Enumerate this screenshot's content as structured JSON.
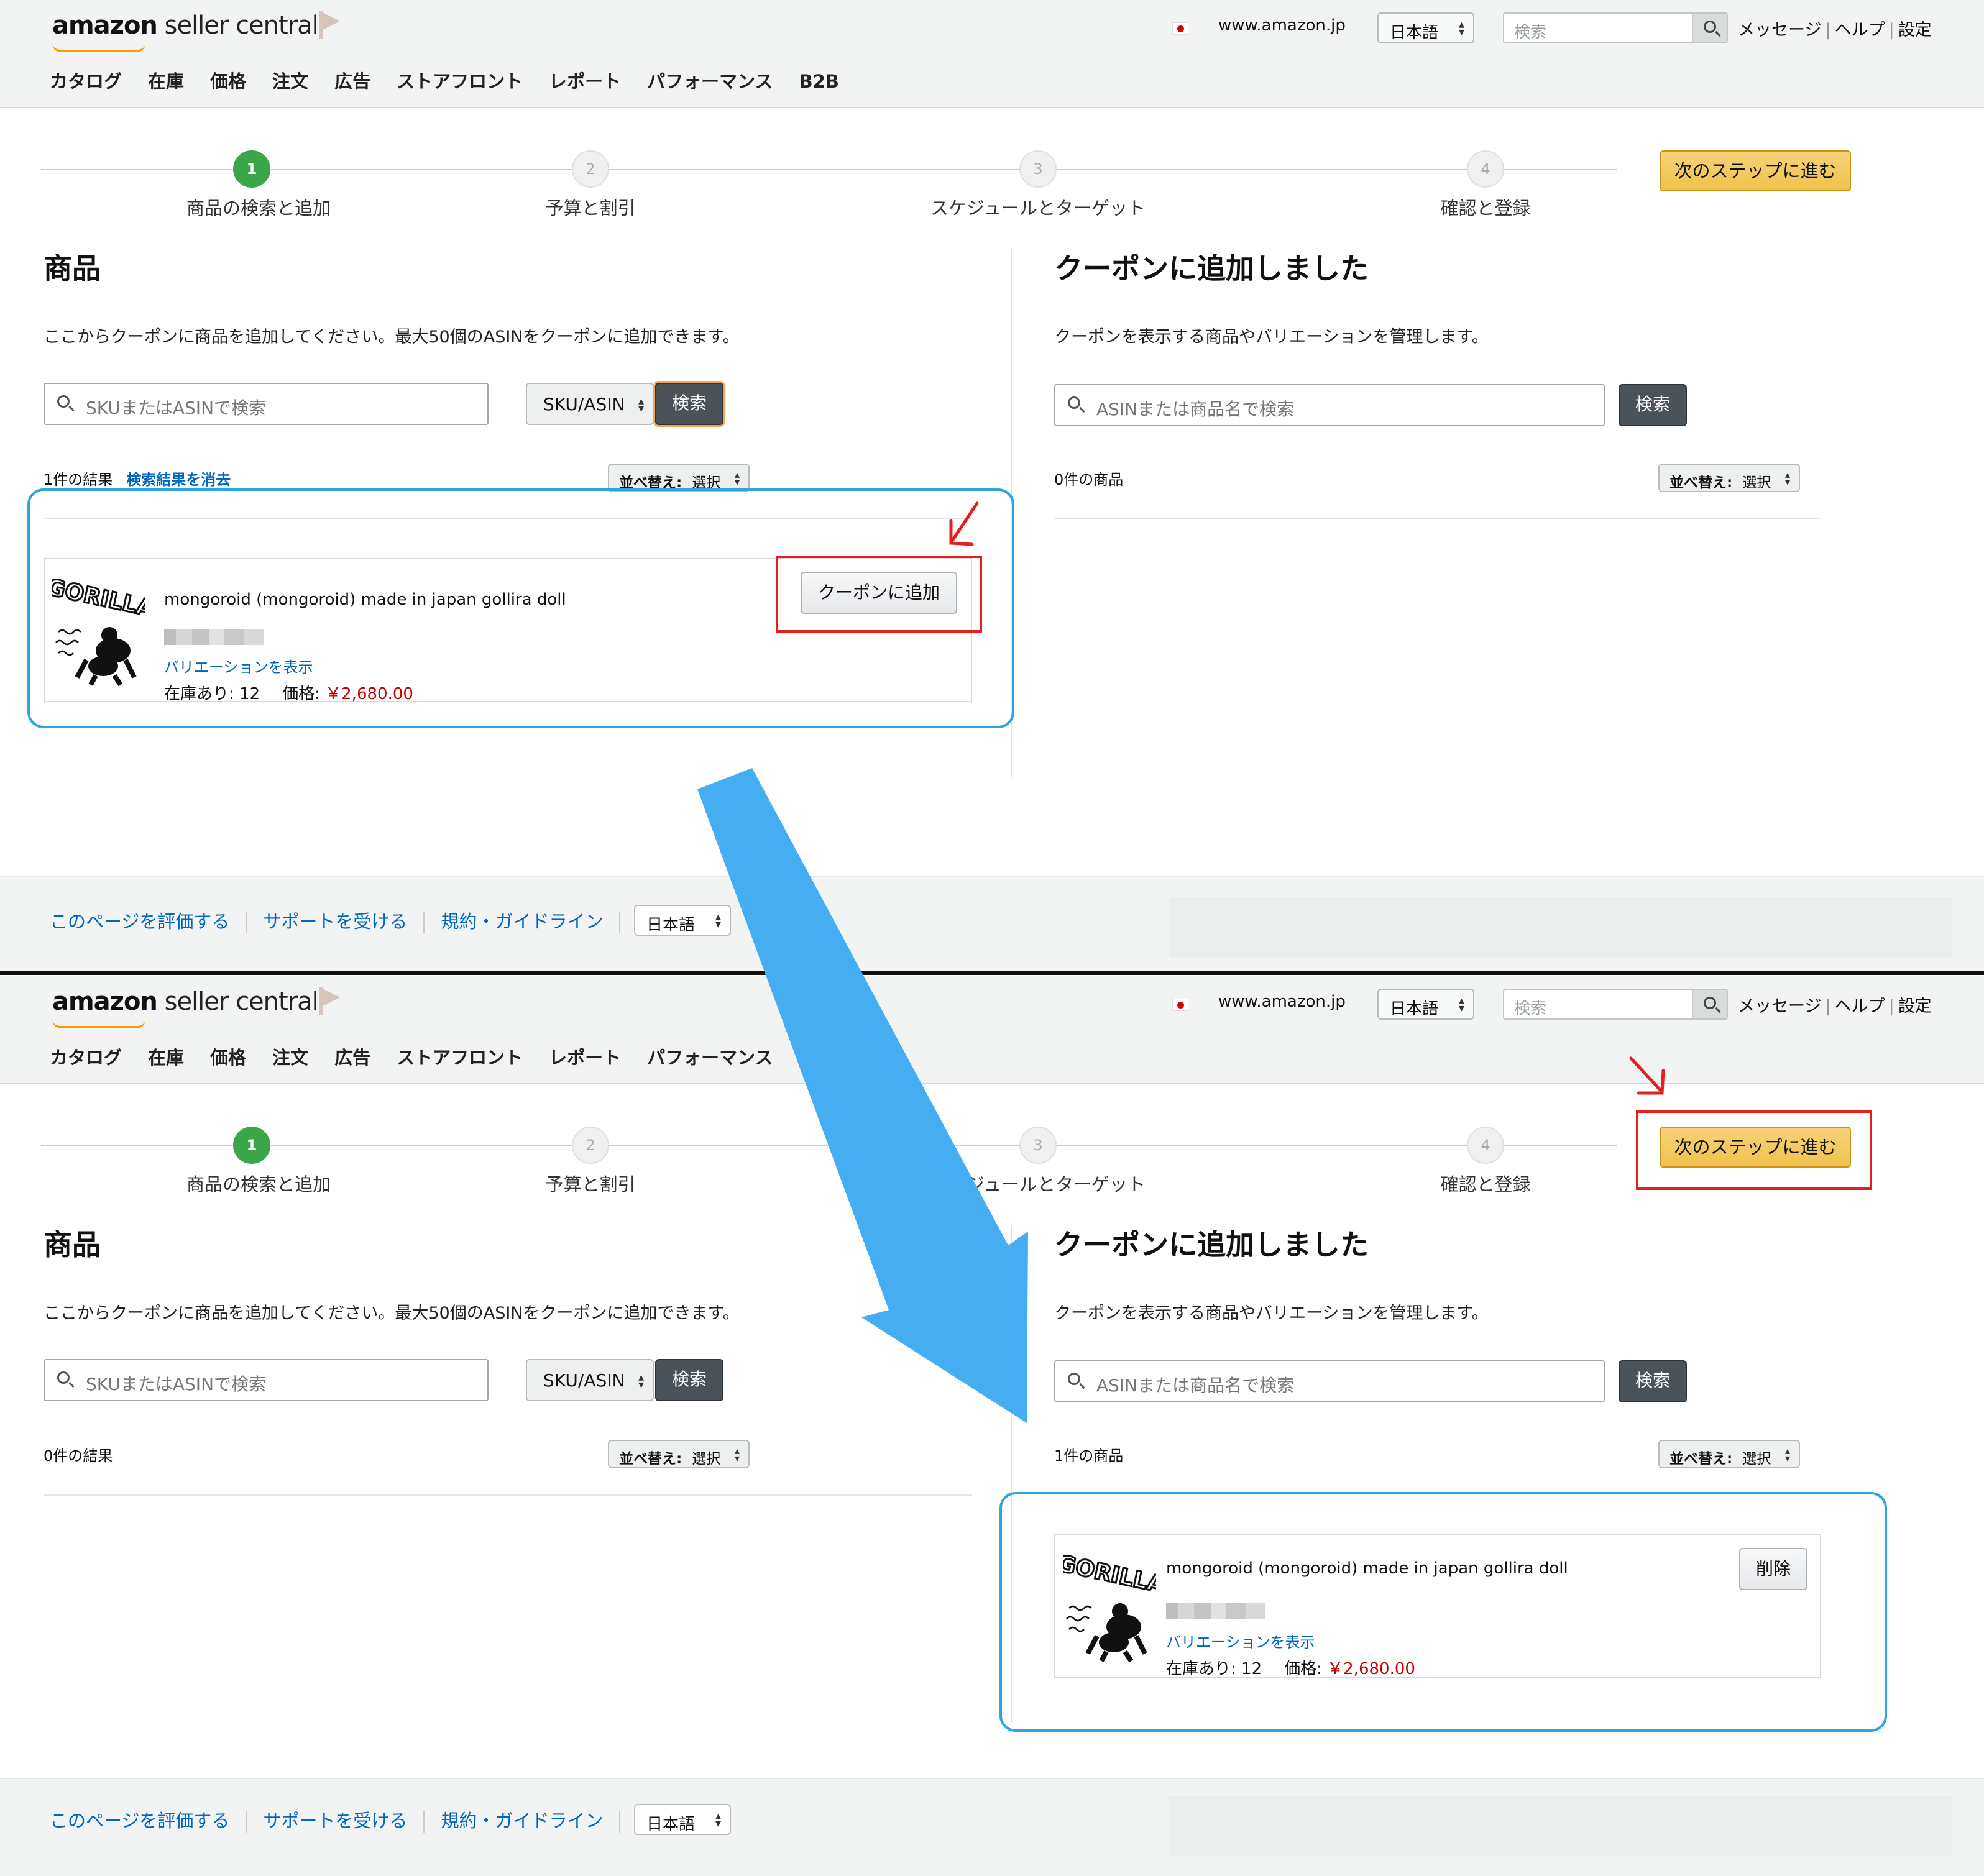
{
  "header": {
    "logo_amazon": "amazon",
    "logo_rest": " seller central",
    "site": "www.amazon.jp",
    "language": "日本語",
    "search_placeholder": "検索",
    "links": [
      "メッセージ",
      "ヘルプ",
      "設定"
    ],
    "nav": [
      "カタログ",
      "在庫",
      "価格",
      "注文",
      "広告",
      "ストアフロント",
      "レポート",
      "パフォーマンス",
      "B2B"
    ]
  },
  "stepper": {
    "steps": [
      {
        "num": "1",
        "label": "商品の検索と追加"
      },
      {
        "num": "2",
        "label": "予算と割引"
      },
      {
        "num": "3",
        "label": "スケジュールとターゲット"
      },
      {
        "num": "4",
        "label": "確認と登録"
      }
    ],
    "next_label": "次のステップに進む"
  },
  "left": {
    "title": "商品",
    "description": "ここからクーポンに商品を追加してください。最大50個のASINをクーポンに追加できます。",
    "search_placeholder": "SKUまたはASINで検索",
    "search_type": "SKU/ASIN",
    "search_button": "検索",
    "results_top": "1件の結果",
    "clear_results": "検索結果を消去",
    "results_bottom": "0件の結果",
    "sort_label": "並べ替え:",
    "sort_value": "選択"
  },
  "right": {
    "title": "クーポンに追加しました",
    "description": "クーポンを表示する商品やバリエーションを管理します。",
    "search_placeholder": "ASINまたは商品名で検索",
    "search_button": "検索",
    "count_top": "0件の商品",
    "count_bottom": "1件の商品",
    "sort_label": "並べ替え:",
    "sort_value": "選択"
  },
  "product": {
    "name": "mongoroid (mongoroid) made in japan gollira doll",
    "thumb_text": "GORILLA",
    "variation_link": "バリエーションを表示",
    "stock": "在庫あり: 12",
    "price_label": "価格:",
    "price": "￥2,680.00",
    "add_button": "クーポンに追加",
    "remove_button": "削除"
  },
  "footer": {
    "links": [
      "このページを評価する",
      "サポートを受ける",
      "規約・ガイドライン"
    ],
    "language": "日本語"
  },
  "annotation_colors": {
    "blue_frame": "#2ba6e0",
    "red_frame": "#e51f1f",
    "big_arrow": "#45aef2"
  }
}
